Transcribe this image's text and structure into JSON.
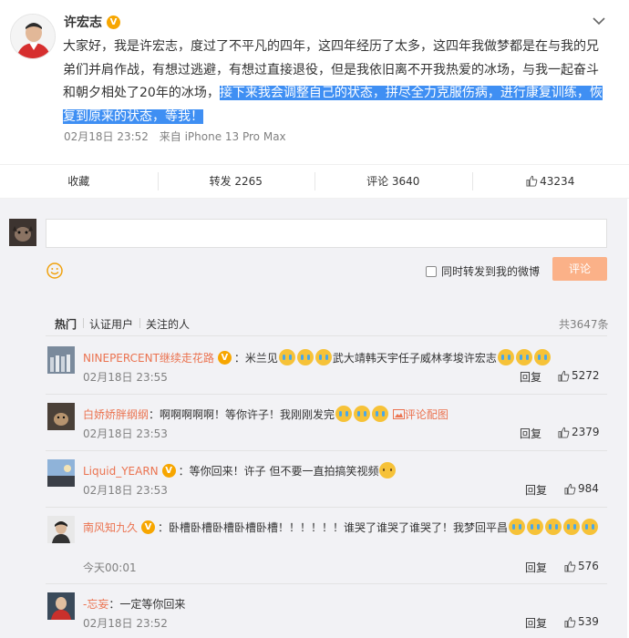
{
  "post": {
    "author": "许宏志",
    "text_a": "大家好，我是许宏志，度过了不平凡的四年，这四年经历了太多，这四年我做梦都是在与我的兄弟们并肩作战，有想过逃避，有想过直接退役，但是我依旧离不开我热爱的冰场，与我一起奋斗和朝夕相处了20年的冰场，",
    "text_b": "接下来我会调整自己的状态，拼尽全力克服伤病，进行康复训练，恢复到原来的状态，等我！",
    "time": "02月18日 23:52",
    "source": "来自 iPhone 13 Pro Max"
  },
  "actions": {
    "favorite": "收藏",
    "repost": "转发 2265",
    "comment": "评论 3640",
    "like": "43234"
  },
  "compose": {
    "input_value": "",
    "repost_label": "同时转发到我的微博",
    "submit": "评论"
  },
  "tabs": [
    "热门",
    "认证用户",
    "关注的人"
  ],
  "total": "共3647条",
  "comments": [
    {
      "user": "NINEPERCENT继续走花路",
      "a": "：米兰见",
      "b": "武大靖韩天宇任子威林孝埈许宏志",
      "time": "02月18日 23:55",
      "reply": "回复",
      "likes": "5272"
    },
    {
      "user": "白娇娇胖纲纲",
      "a": "：啊啊啊啊啊！等你许子！我刚刚发完",
      "link": "评论配图",
      "time": "02月18日 23:53",
      "reply": "回复",
      "likes": "2379"
    },
    {
      "user": "Liquid_YEARN",
      "a": "：等你回来！许子 但不要一直拍搞笑视频",
      "time": "02月18日 23:53",
      "reply": "回复",
      "likes": "984"
    },
    {
      "user": "南风知九久",
      "a": "：卧槽卧槽卧槽卧槽卧槽！！！！！！谁哭了谁哭了谁哭了！我梦回平昌",
      "time": "今天00:01",
      "reply": "回复",
      "likes": "576"
    },
    {
      "user": "-忘妄",
      "a": "：一定等你回来",
      "time": "02月18日 23:52",
      "reply": "回复",
      "likes": "539"
    }
  ],
  "icons": {
    "verified": "verified-v-badge",
    "more": "chevron-down-icon",
    "like": "thumbs-up-icon",
    "emoji": "smile-icon",
    "crying": "crying-emoji-icon"
  },
  "colors": {
    "accent": "#eb7350",
    "highlight": "#3f8ff3",
    "button": "#fbb188",
    "badge": "#f7a600",
    "panel": "#f2f2f5"
  }
}
